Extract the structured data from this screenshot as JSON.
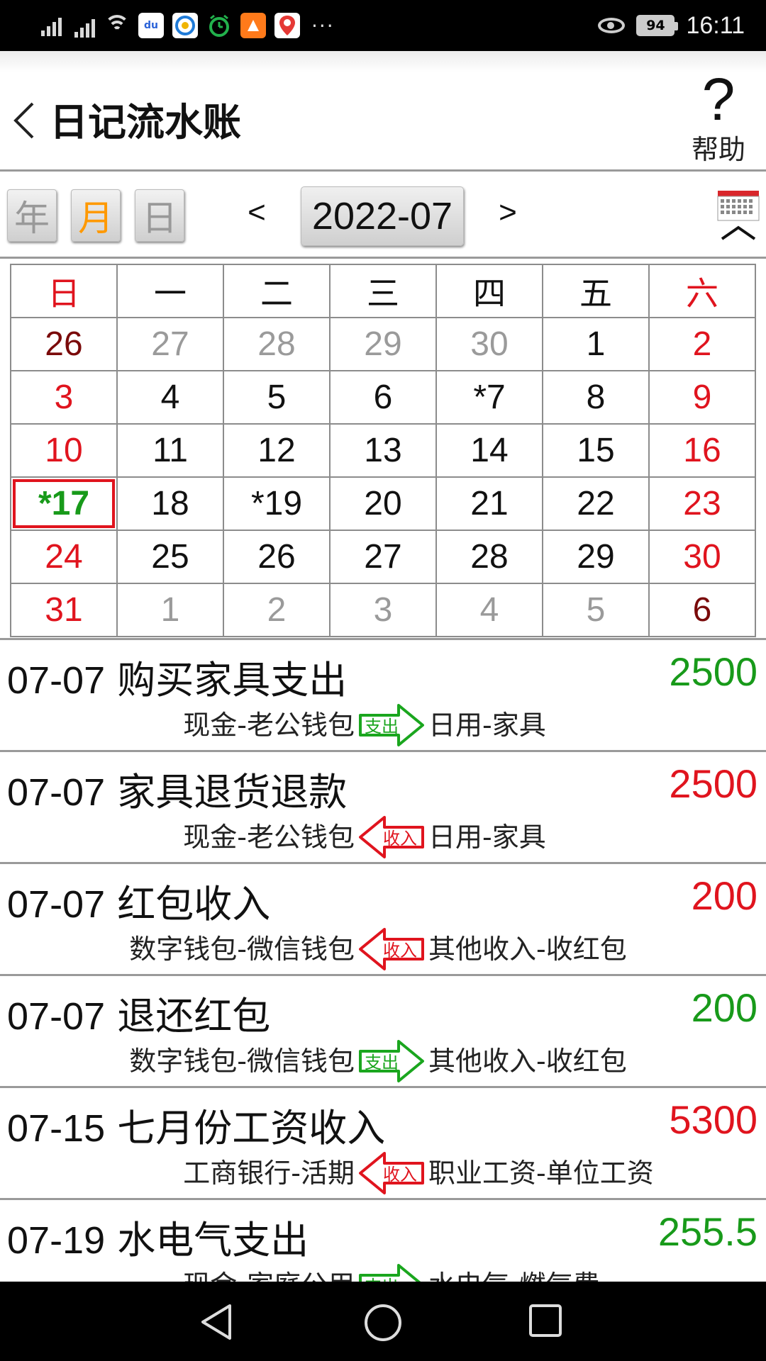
{
  "status_bar": {
    "time": "16:11",
    "battery": "94",
    "more": "···",
    "colors": {
      "background": "#000000",
      "text": "#eeeeee"
    }
  },
  "header": {
    "title": "日记流水账",
    "help_label": "帮助",
    "help_icon": "?"
  },
  "toolbar": {
    "modes": [
      {
        "label": "年",
        "active": false
      },
      {
        "label": "月",
        "active": true
      },
      {
        "label": "日",
        "active": false
      }
    ],
    "prev": "<",
    "next": ">",
    "current_month": "2022-07",
    "active_color": "#ff9900"
  },
  "calendar": {
    "weekdays": [
      "日",
      "一",
      "二",
      "三",
      "四",
      "五",
      "六"
    ],
    "weeks": [
      [
        {
          "label": "26",
          "style": "maroon"
        },
        {
          "label": "27",
          "style": "gray"
        },
        {
          "label": "28",
          "style": "gray"
        },
        {
          "label": "29",
          "style": "gray"
        },
        {
          "label": "30",
          "style": "gray"
        },
        {
          "label": "1",
          "style": "dark"
        },
        {
          "label": "2",
          "style": "red"
        }
      ],
      [
        {
          "label": "3",
          "style": "red"
        },
        {
          "label": "4",
          "style": "dark"
        },
        {
          "label": "5",
          "style": "dark"
        },
        {
          "label": "6",
          "style": "dark"
        },
        {
          "label": "*7",
          "style": "dark"
        },
        {
          "label": "8",
          "style": "dark"
        },
        {
          "label": "9",
          "style": "red"
        }
      ],
      [
        {
          "label": "10",
          "style": "red"
        },
        {
          "label": "11",
          "style": "dark"
        },
        {
          "label": "12",
          "style": "dark"
        },
        {
          "label": "13",
          "style": "dark"
        },
        {
          "label": "14",
          "style": "dark"
        },
        {
          "label": "15",
          "style": "dark"
        },
        {
          "label": "16",
          "style": "red"
        }
      ],
      [
        {
          "label": "*17",
          "style": "green",
          "today": true
        },
        {
          "label": "18",
          "style": "dark"
        },
        {
          "label": "*19",
          "style": "dark"
        },
        {
          "label": "20",
          "style": "dark"
        },
        {
          "label": "21",
          "style": "dark"
        },
        {
          "label": "22",
          "style": "dark"
        },
        {
          "label": "23",
          "style": "red"
        }
      ],
      [
        {
          "label": "24",
          "style": "red"
        },
        {
          "label": "25",
          "style": "dark"
        },
        {
          "label": "26",
          "style": "dark"
        },
        {
          "label": "27",
          "style": "dark"
        },
        {
          "label": "28",
          "style": "dark"
        },
        {
          "label": "29",
          "style": "dark"
        },
        {
          "label": "30",
          "style": "red"
        }
      ],
      [
        {
          "label": "31",
          "style": "red"
        },
        {
          "label": "1",
          "style": "gray"
        },
        {
          "label": "2",
          "style": "gray"
        },
        {
          "label": "3",
          "style": "gray"
        },
        {
          "label": "4",
          "style": "gray"
        },
        {
          "label": "5",
          "style": "gray"
        },
        {
          "label": "6",
          "style": "maroon"
        }
      ]
    ],
    "colors": {
      "weekend": "#e0141e",
      "today": "#189a1a",
      "other_month": "#9a9a9a"
    }
  },
  "entries": [
    {
      "date": "07-07",
      "desc": "购买家具支出",
      "amount": "2500",
      "kind": "expense",
      "from": "现金-老公钱包",
      "to": "日用-家具",
      "badge": "支出"
    },
    {
      "date": "07-07",
      "desc": "家具退货退款",
      "amount": "2500",
      "kind": "income",
      "from": "现金-老公钱包",
      "to": "日用-家具",
      "badge": "收入"
    },
    {
      "date": "07-07",
      "desc": "红包收入",
      "amount": "200",
      "kind": "income",
      "from": "数字钱包-微信钱包",
      "to": "其他收入-收红包",
      "badge": "收入"
    },
    {
      "date": "07-07",
      "desc": "退还红包",
      "amount": "200",
      "kind": "expense",
      "from": "数字钱包-微信钱包",
      "to": "其他收入-收红包",
      "badge": "支出"
    },
    {
      "date": "07-15",
      "desc": "七月份工资收入",
      "amount": "5300",
      "kind": "income",
      "from": "工商银行-活期",
      "to": "职业工资-单位工资",
      "badge": "收入"
    },
    {
      "date": "07-19",
      "desc": "水电气支出",
      "amount": "255.5",
      "kind": "expense",
      "from": "现金-家庭公用",
      "to": "水电气-燃气费",
      "badge": "支出"
    }
  ],
  "amount_colors": {
    "expense": "#189a1a",
    "income": "#e0141e"
  },
  "icons": {
    "back": "chevron-left-icon",
    "calendar": "calendar-icon",
    "nav": [
      "back-triangle-icon",
      "home-circle-icon",
      "recents-square-icon"
    ]
  }
}
